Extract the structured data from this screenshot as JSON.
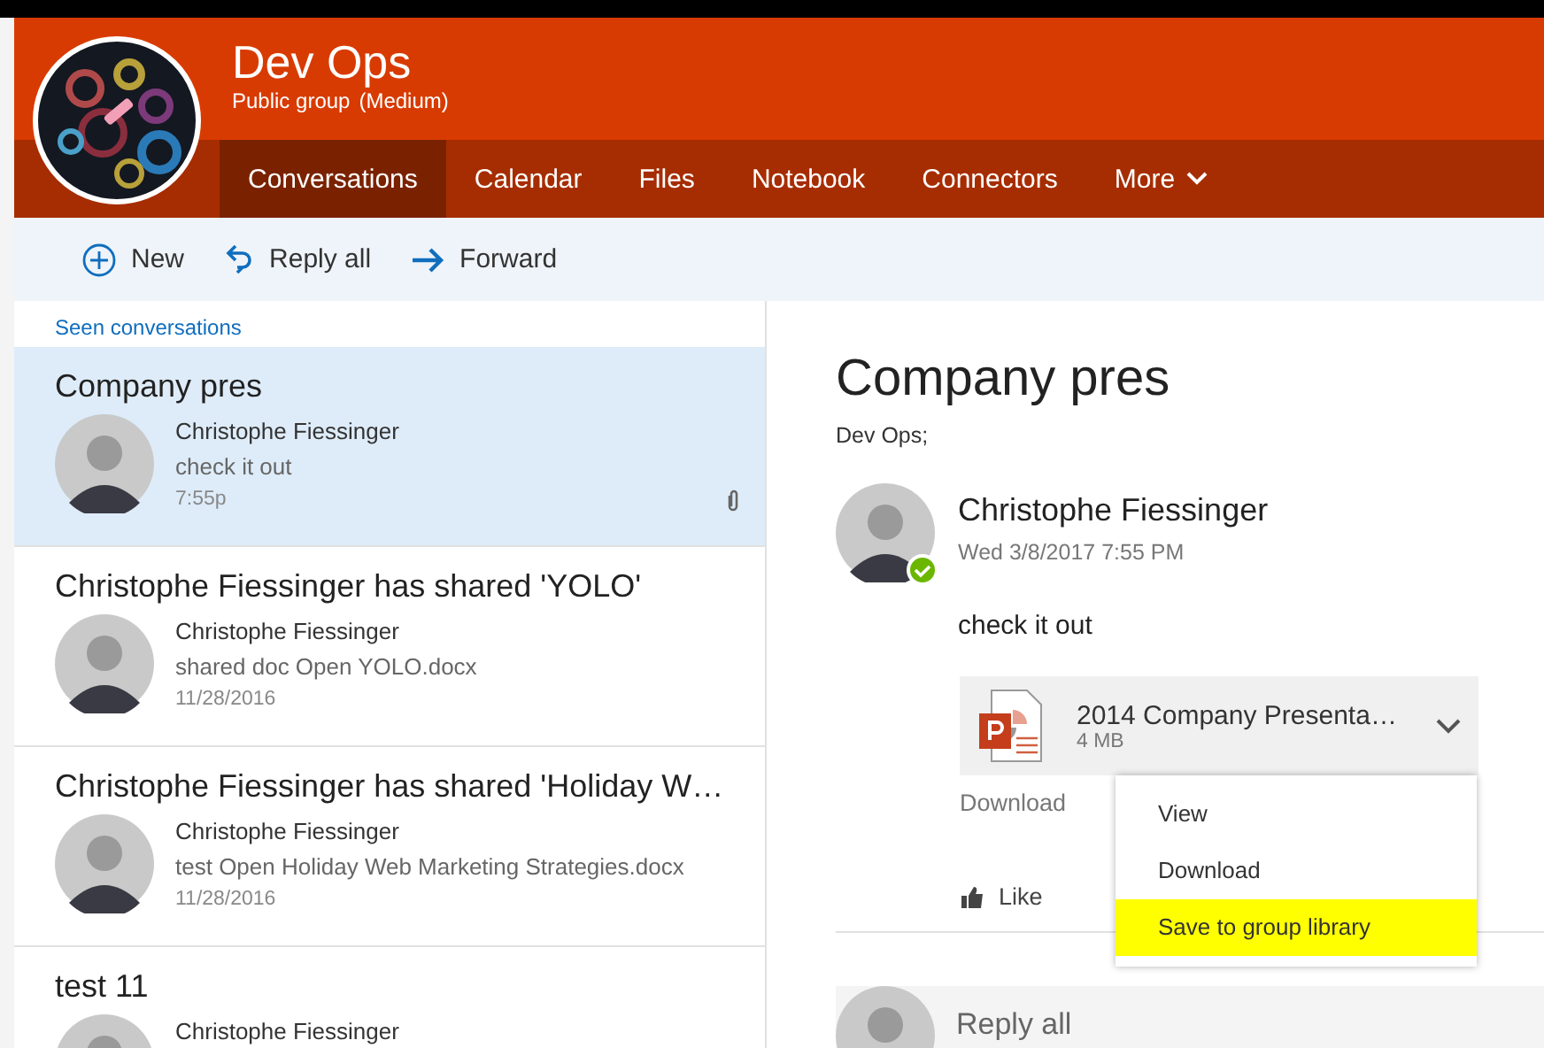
{
  "group": {
    "name": "Dev Ops",
    "subtitle": "Public group",
    "classification": "(Medium)"
  },
  "nav": [
    {
      "label": "Conversations",
      "selected": true,
      "kind": "tab"
    },
    {
      "label": "Calendar",
      "selected": false,
      "kind": "tab"
    },
    {
      "label": "Files",
      "selected": false,
      "kind": "tab"
    },
    {
      "label": "Notebook",
      "selected": false,
      "kind": "tab"
    },
    {
      "label": "Connectors",
      "selected": false,
      "kind": "tab"
    },
    {
      "label": "More",
      "selected": false,
      "kind": "dropdown"
    }
  ],
  "toolbar": [
    {
      "label": "New",
      "kind": "new"
    },
    {
      "label": "Reply all",
      "kind": "reply_all"
    },
    {
      "label": "Forward",
      "kind": "forward"
    }
  ],
  "list": {
    "heading": "Seen conversations",
    "conversations": [
      {
        "subject": "Company pres",
        "sender": "Christophe Fiessinger",
        "preview": "check it out",
        "time": "7:55p",
        "selected": true,
        "has_attachment": true
      },
      {
        "subject": "Christophe Fiessinger has shared 'YOLO'",
        "sender": "Christophe Fiessinger",
        "preview": "shared doc Open YOLO.docx",
        "time": "11/28/2016",
        "selected": false,
        "has_attachment": false
      },
      {
        "subject": "Christophe Fiessinger has shared 'Holiday W…",
        "sender": "Christophe Fiessinger",
        "preview": "test Open Holiday Web Marketing Strategies.docx",
        "time": "11/28/2016",
        "selected": false,
        "has_attachment": false
      },
      {
        "subject": "test 11",
        "sender": "Christophe Fiessinger",
        "selected": false,
        "has_attachment": false
      }
    ]
  },
  "message": {
    "subject": "Company pres",
    "recipients": "Dev Ops;",
    "sender": "Christophe Fiessinger",
    "date": "Wed 3/8/2017 7:55 PM",
    "online": true,
    "body": "check it out",
    "attachment": {
      "name": "2014 Company Presenta…",
      "size": "4 MB"
    },
    "download_label": "Download",
    "like_label": "Like",
    "reply_placeholder": "Reply all"
  },
  "menu": {
    "items": [
      {
        "label": "View",
        "highlighted": false
      },
      {
        "label": "Download",
        "highlighted": false
      },
      {
        "label": "Save to group library",
        "highlighted": true
      }
    ]
  }
}
